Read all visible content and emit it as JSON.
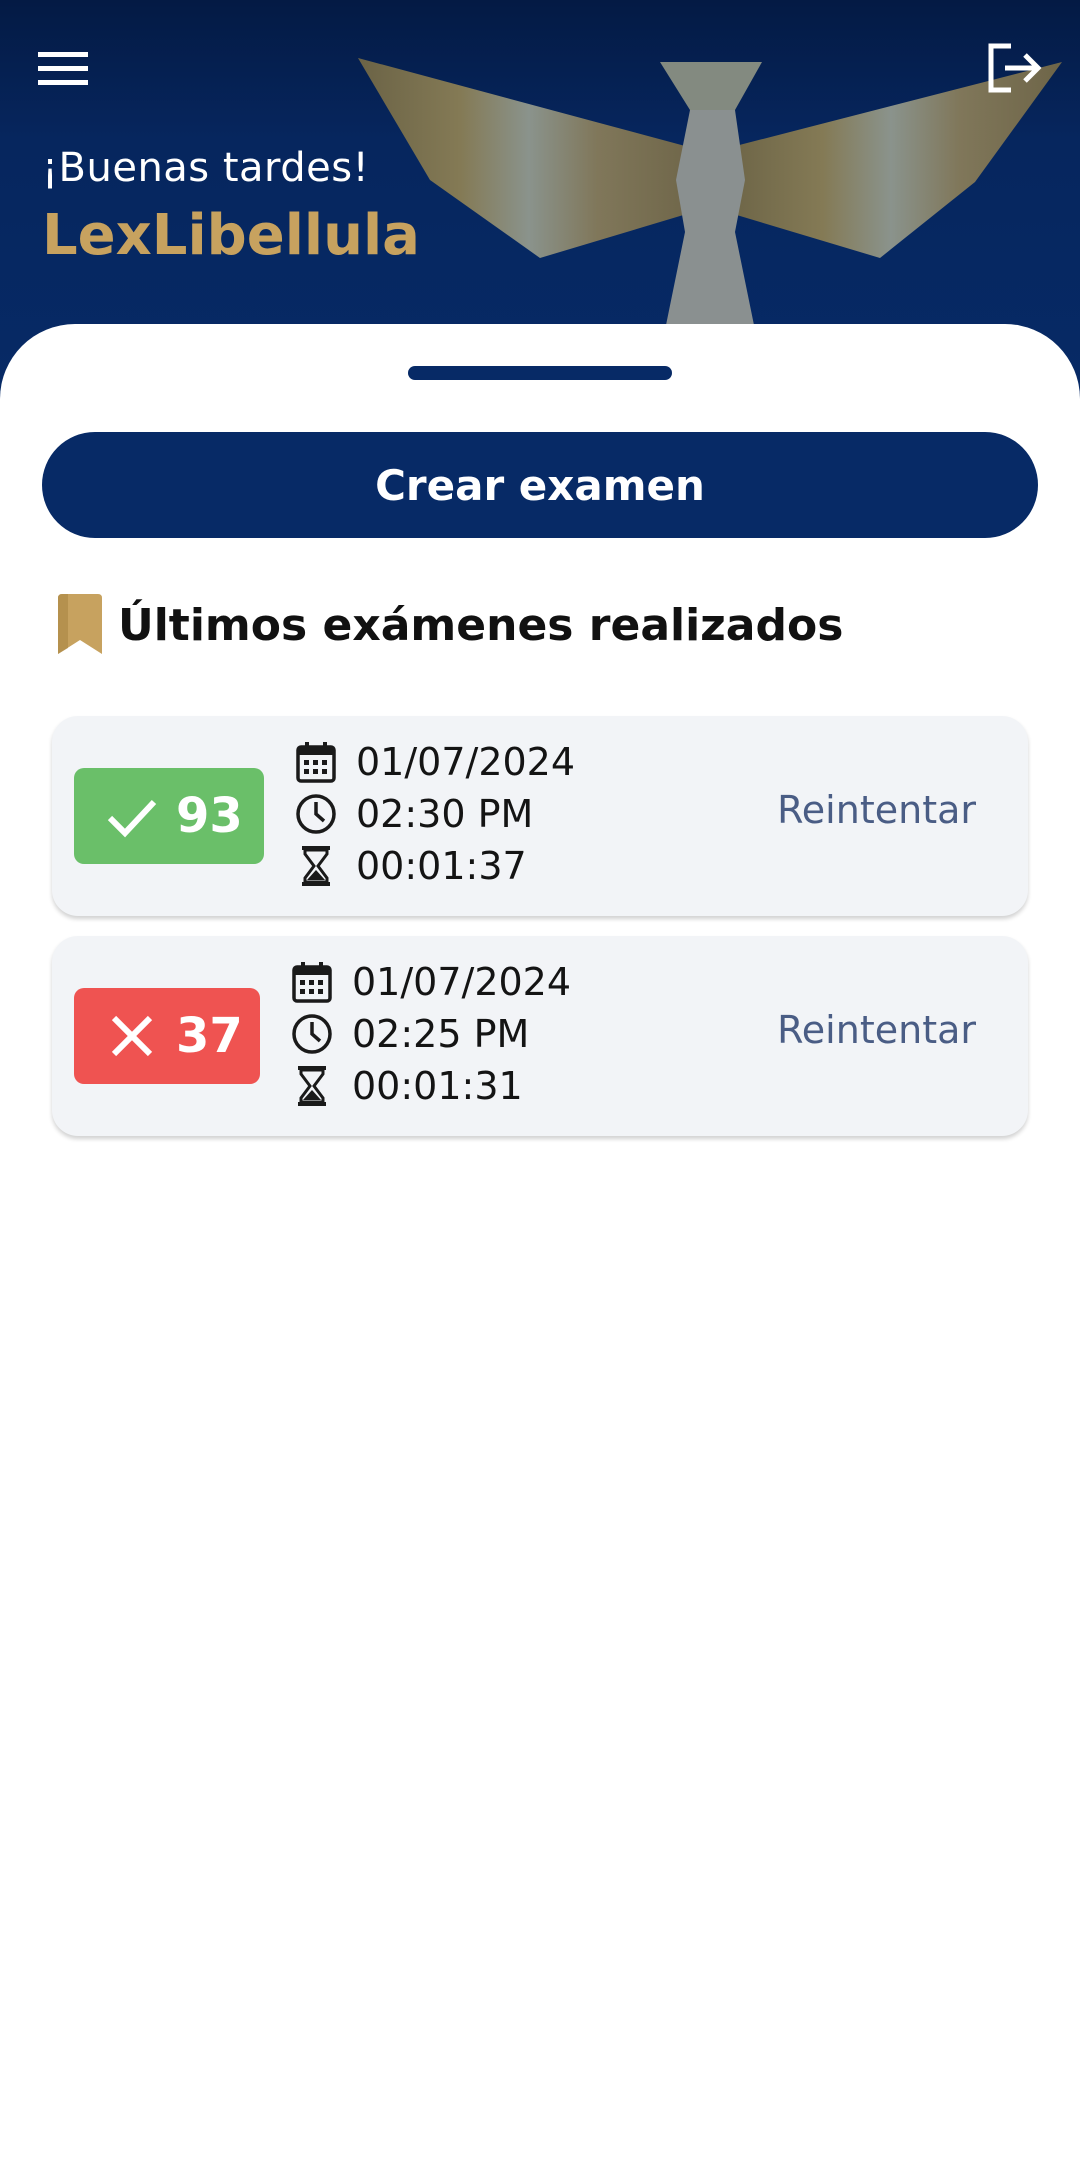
{
  "header": {
    "greeting": "¡Buenas tardes!",
    "username": "LexLibellula",
    "menu_icon": "menu-icon",
    "logout_icon": "logout-icon"
  },
  "actions": {
    "create_exam_label": "Crear examen"
  },
  "section": {
    "icon": "bookmark-icon",
    "title": "Últimos exámenes realizados"
  },
  "exams": [
    {
      "status": "pass",
      "score": "93",
      "date": "01/07/2024",
      "time": "02:30 PM",
      "duration": "00:01:37",
      "retry_label": "Reintentar"
    },
    {
      "status": "fail",
      "score": "37",
      "date": "01/07/2024",
      "time": "02:25 PM",
      "duration": "00:01:31",
      "retry_label": "Reintentar"
    }
  ],
  "colors": {
    "primary": "#072a66",
    "accent_gold": "#c7a25f",
    "pass": "#6abf69",
    "fail": "#ef5351",
    "retry_text": "#4a5d85",
    "card_bg": "#f2f4f7"
  }
}
